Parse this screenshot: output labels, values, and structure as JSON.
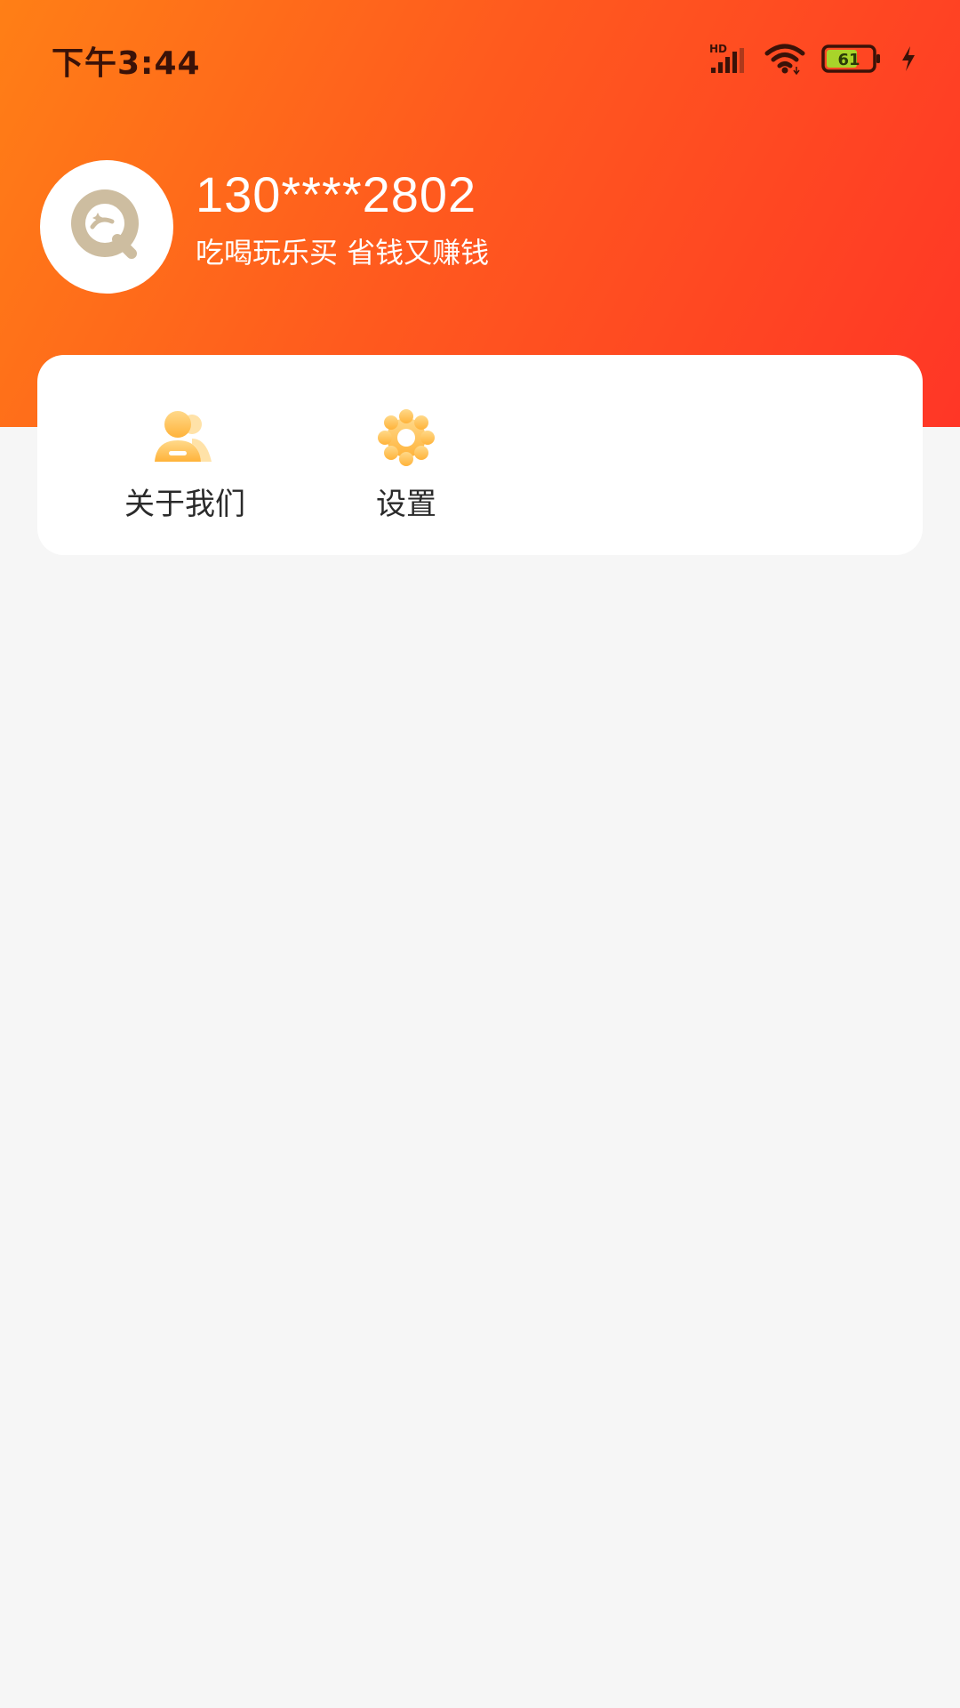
{
  "status_bar": {
    "time": "下午3:44",
    "network_label": "HD",
    "battery_level": "61",
    "battery_color": "#a8d42a",
    "icons": [
      "hd-signal-icon",
      "wifi-icon",
      "battery-icon",
      "charging-bolt-icon"
    ]
  },
  "profile": {
    "username": "130****2802",
    "slogan": "吃喝玩乐买 省钱又赚钱",
    "avatar_icon": "app-logo-icon"
  },
  "menu": {
    "items": [
      {
        "label": "关于我们",
        "icon": "about-us-icon"
      },
      {
        "label": "设置",
        "icon": "settings-gear-icon"
      }
    ]
  },
  "colors": {
    "header_gradient_start": "#ff7f16",
    "header_gradient_end": "#ff3626",
    "icon_accent": "#ffc454",
    "avatar_logo": "#cdbda0",
    "page_background": "#f6f6f6"
  }
}
